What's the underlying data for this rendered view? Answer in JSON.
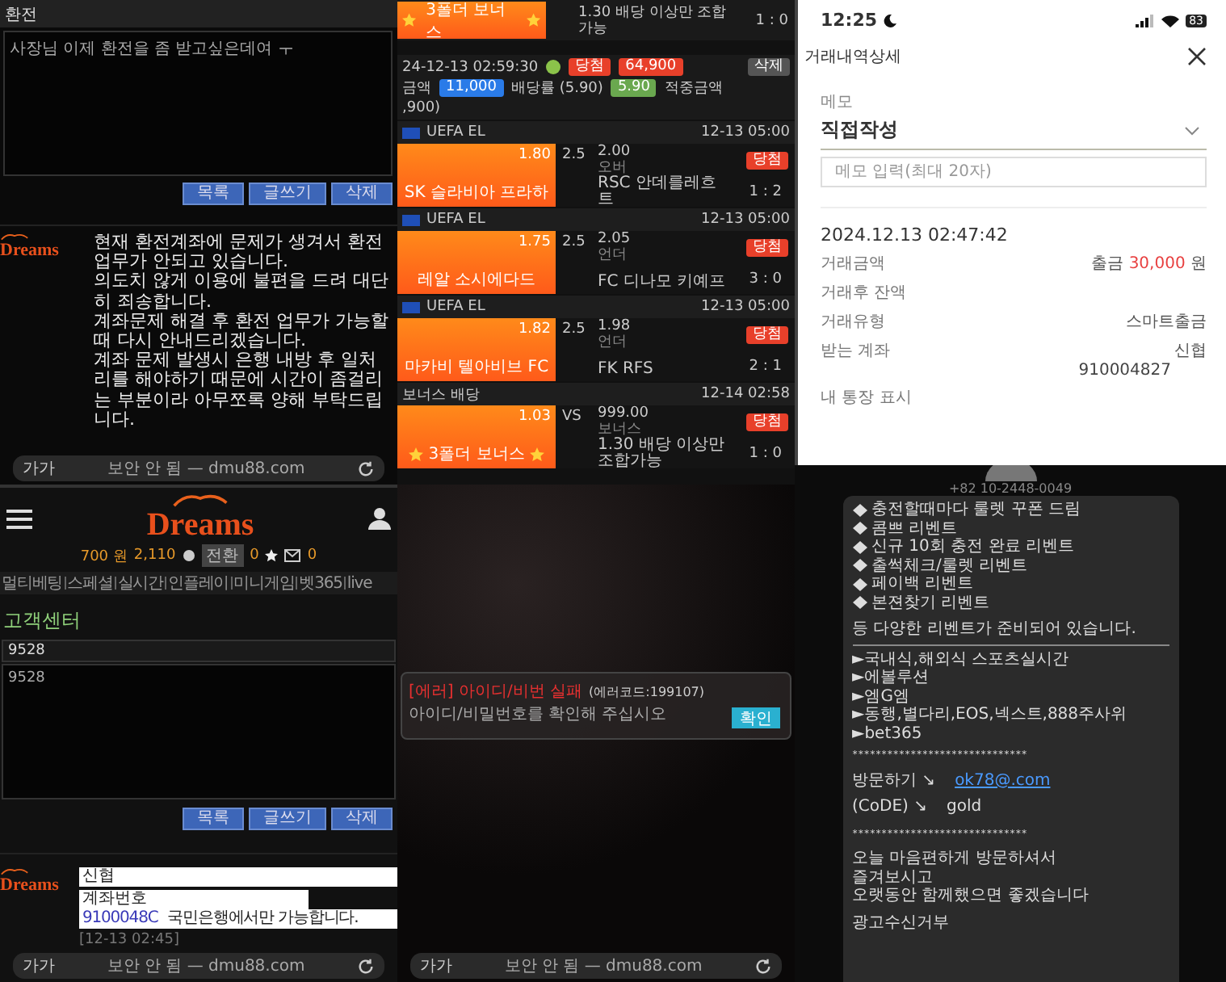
{
  "exchange_post": {
    "header": "환전",
    "message_field": {
      "value": "사장님 이제 환전을 좀 받고싶은데여 ㅜ"
    },
    "buttons": [
      "목록",
      "글쓰기",
      "삭제"
    ],
    "reply": {
      "logo": "Dreams",
      "paragraphs": [
        "현재 환전계좌에 문제가 생겨서 환전업무가 안되고 있습니다.",
        "의도치 않게 이용에 불편을 드려 대단히 죄송합니다.",
        "계좌문제 해결 후 환전 업무가 가능할때 다시 안내드리겠습니다.",
        "계좌 문제 발생시 은행 내방 후 일처리를 해야하기 때문에 시간이 좀걸리는 부분이라 아무쪼록 양해 부탁드립니다."
      ]
    },
    "url_bar": {
      "text_size": "가가",
      "address": "보안 안 됨 — dmu88.com"
    }
  },
  "customer_center": {
    "logo": "Dreams",
    "money": "700 원",
    "points": "2,110",
    "convert": "전환",
    "favorites_count": "0",
    "mail_count": "0",
    "nav": [
      "멀티베팅",
      "스페셜",
      "실시간",
      "인플레이",
      "미니게임",
      "벳365",
      "live"
    ],
    "title": "고객센터",
    "subject_field": {
      "value": "9528"
    },
    "body_field": {
      "value": "9528"
    },
    "buttons": [
      "목록",
      "글쓰기",
      "삭제"
    ],
    "reply": {
      "logo": "Dreams",
      "bank": "신협",
      "account_label": "계좌번호",
      "account": "9100048C",
      "note": "국민은행에서만 가능합니다.",
      "time": "[12-13 02:45]"
    },
    "url_bar": {
      "text_size": "가가",
      "address": "보안 안 됨 — dmu88.com"
    }
  },
  "bet_slip": {
    "top_bonus": {
      "label": "3폴더 보너스",
      "note": "1.30 배당 이상만 조합가능",
      "score": "1 : 0"
    },
    "ticket": {
      "datetime": "24-12-13 02:59:30",
      "result": "당첨",
      "payout": "64,900",
      "delete": "삭제",
      "stake_label": "금액",
      "stake": "11,000",
      "odds_label": "배당률 (5.90)",
      "odds": "5.90",
      "win_label": "적중금액",
      "win_amount": ",900)"
    },
    "sections": [
      {
        "kind": "match",
        "league": "UEFA EL",
        "time": "12-13 05:00",
        "home_odds": "1.80",
        "home": "SK 슬라비아 프라하",
        "line": "2.5",
        "pick_odds": "2.00",
        "pick": "오버",
        "away": "RSC 안데를레흐트",
        "result": "당첨",
        "score": "1 : 2"
      },
      {
        "kind": "match",
        "league": "UEFA EL",
        "time": "12-13 05:00",
        "home_odds": "1.75",
        "home": "레알 소시에다드",
        "line": "2.5",
        "pick_odds": "2.05",
        "pick": "언더",
        "away": "FC 디나모 키예프",
        "result": "당첨",
        "score": "3 : 0"
      },
      {
        "kind": "match",
        "league": "UEFA EL",
        "time": "12-13 05:00",
        "home_odds": "1.82",
        "home": "마카비 텔아비브 FC",
        "line": "2.5",
        "pick_odds": "1.98",
        "pick": "언더",
        "away": "FK RFS",
        "result": "당첨",
        "score": "2 : 1"
      },
      {
        "kind": "bonus",
        "league": "보너스 배당",
        "time": "12-14 02:58",
        "home_odds": "1.03",
        "home": "3폴더 보너스",
        "line": "VS",
        "pick_odds": "999.00",
        "pick": "보너스",
        "away": "1.30 배당 이상만 조합가능",
        "result": "당첨",
        "score": "1 : 0"
      }
    ]
  },
  "login_error": {
    "title": "[에러] 아이디/비번 실패",
    "code": "(에러코드:199107)",
    "message": "아이디/비밀번호를 확인해 주십시오",
    "button": "확인",
    "url_bar": {
      "text_size": "가가",
      "address": "보안 안 됨 — dmu88.com"
    }
  },
  "bank_detail": {
    "status_time": "12:25",
    "battery": "83",
    "title": "거래내역상세",
    "memo_label": "메모",
    "memo_select": "직접작성",
    "memo_input": {
      "placeholder": "메모 입력(최대 20자)"
    },
    "datetime": "2024.12.13 02:47:42",
    "rows": [
      {
        "label": "거래금액",
        "prefix": "출금",
        "amount": "30,000",
        "unit": "원"
      },
      {
        "label": "거래후 잔액"
      },
      {
        "label": "거래유형",
        "value": "스마트출금"
      },
      {
        "label": "받는 계좌",
        "value": "신협",
        "sub": "910004827"
      },
      {
        "label": "내 통장 표시"
      }
    ]
  },
  "sms": {
    "phone": "+82 10-2448-0049",
    "events": [
      "충전할때마다 룰렛 꾸폰 드림",
      "콤쁘 리벤트",
      "신규  10회 충전 완료 리벤트",
      "출썩체크/룰렛 리벤트",
      "페이백 리벤트",
      "본젼찾기 리벤트"
    ],
    "events_closing": "등 다양한 리벤트가 준비되어 있습니다.",
    "games": [
      "►국내식,해외식 스포츠실시간",
      "►에볼루션",
      "►엠G엠",
      "►동행,별다리,EOS,넥스트,888주사위",
      "►bet365"
    ],
    "separator_1": "******************************",
    "visit_label": "방문하기 ↘",
    "visit_link": "ok78@.com",
    "code_label": "(CᴏDE) ↘",
    "code": "gold",
    "separator_2": "******************************",
    "closing": [
      "오늘 마음편하게 방문하셔서",
      "즐겨보시고",
      "오랫동안 함께했으면 좋겠습니다"
    ],
    "optout": "광고수신거부"
  }
}
